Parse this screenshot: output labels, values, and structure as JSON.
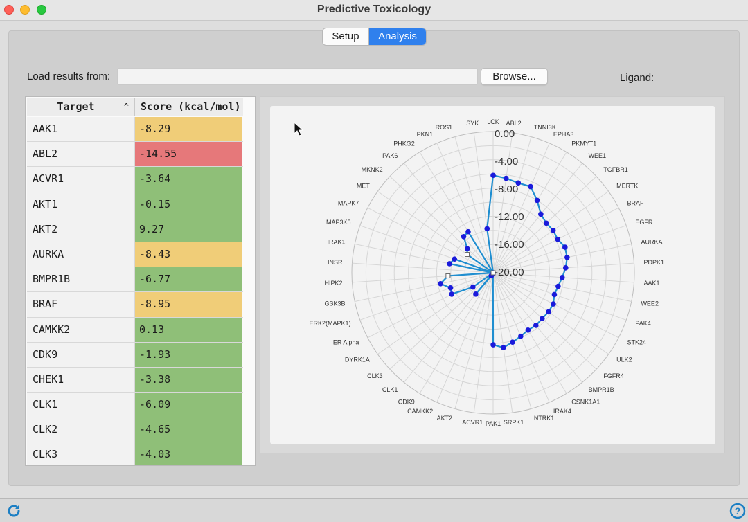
{
  "window": {
    "title": "Predictive Toxicology"
  },
  "tabs": [
    {
      "label": "Setup",
      "active": false
    },
    {
      "label": "Analysis",
      "active": true
    }
  ],
  "load": {
    "label": "Load results from:",
    "value": "",
    "browse_label": "Browse..."
  },
  "ligand": {
    "label": "Ligand:"
  },
  "table": {
    "headers": {
      "target": "Target",
      "score": "Score (kcal/mol)"
    },
    "sort_indicator": "^",
    "rows": [
      {
        "target": "AAK1",
        "score": "-8.29",
        "color": "#f0cd78"
      },
      {
        "target": "ABL2",
        "score": "-14.55",
        "color": "#e6787a"
      },
      {
        "target": "ACVR1",
        "score": "-3.64",
        "color": "#8fbf78"
      },
      {
        "target": "AKT1",
        "score": "-0.15",
        "color": "#8fbf78"
      },
      {
        "target": "AKT2",
        "score": "9.27",
        "color": "#8fbf78"
      },
      {
        "target": "AURKA",
        "score": "-8.43",
        "color": "#f0cd78"
      },
      {
        "target": "BMPR1B",
        "score": "-6.77",
        "color": "#8fbf78"
      },
      {
        "target": "BRAF",
        "score": "-8.95",
        "color": "#f0cd78"
      },
      {
        "target": "CAMKK2",
        "score": "0.13",
        "color": "#8fbf78"
      },
      {
        "target": "CDK9",
        "score": "-1.93",
        "color": "#8fbf78"
      },
      {
        "target": "CHEK1",
        "score": "-3.38",
        "color": "#8fbf78"
      },
      {
        "target": "CLK1",
        "score": "-6.09",
        "color": "#8fbf78"
      },
      {
        "target": "CLK2",
        "score": "-4.65",
        "color": "#8fbf78"
      },
      {
        "target": "CLK3",
        "score": "-4.03",
        "color": "#8fbf78"
      }
    ]
  },
  "chart_data": {
    "type": "radar",
    "title": "",
    "rlim": [
      0,
      -20
    ],
    "rticks": [
      "0.00",
      "-4.00",
      "-8.00",
      "-12.00",
      "-16.00",
      "-20.00"
    ],
    "categories": [
      "LCK",
      "ABL2",
      "TNNI3K",
      "EPHA3",
      "PKMYT1",
      "WEE1",
      "TGFBR1",
      "MERTK",
      "BRAF",
      "EGFR",
      "AURKA",
      "PDPK1",
      "AAK1",
      "WEE2",
      "PAK4",
      "STK24",
      "ULK2",
      "FGFR4",
      "BMPR1B",
      "CSNK1A1",
      "IRAK4",
      "NTRK1",
      "SRPK1",
      "PAK1",
      "ACVR1",
      "AKT2",
      "CAMKK2",
      "CDK9",
      "CLK1",
      "CLK3",
      "DYRK1A",
      "ER Alpha",
      "ERK2(MAPK1)",
      "GSK3B",
      "HIPK2",
      "INSR",
      "IRAK1",
      "MAP3K5",
      "MAPK7",
      "MET",
      "MKNK2",
      "PAK6",
      "PHKG2",
      "PKN1",
      "ROS1",
      "SYK"
    ],
    "values": [
      -13.8,
      -13.5,
      -13.2,
      -13.3,
      -12.0,
      -10.7,
      -10.3,
      -10.4,
      -10.3,
      -10.8,
      -10.7,
      -10.3,
      -9.8,
      -9.4,
      -9.2,
      -9.6,
      -9.6,
      -9.5,
      -9.6,
      -9.5,
      -9.8,
      -10.2,
      -10.7,
      -10.2,
      -0.15,
      0.0,
      0.0,
      -0.5,
      -3.9,
      0.0,
      -3.5,
      -6.6,
      -6.4,
      -7.6,
      -6.4,
      0.0,
      -6.3,
      -5.8,
      0.0,
      -4.5,
      -5.0,
      -6.6,
      -6.8,
      0.0,
      0.0,
      -6.3
    ],
    "marker_square": [
      "AKT2",
      "CAMKK2",
      "CLK3",
      "HIPK2",
      "MAPK7",
      "MET",
      "PKN1",
      "ROS1"
    ],
    "series_color": "#1f8ed0",
    "point_color": "#1a1adb"
  },
  "icons": {
    "refresh": "refresh-icon",
    "help": "help-icon",
    "sort": "chevron-up-icon",
    "cursor": "mouse-pointer-icon"
  }
}
